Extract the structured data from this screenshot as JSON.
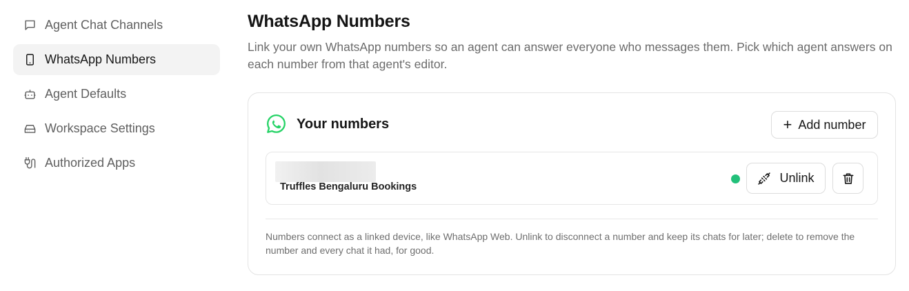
{
  "sidebar": {
    "items": [
      {
        "label": "Agent Chat Channels",
        "icon": "chat-bubble-icon",
        "active": false
      },
      {
        "label": "WhatsApp Numbers",
        "icon": "phone-icon",
        "active": true
      },
      {
        "label": "Agent Defaults",
        "icon": "robot-icon",
        "active": false
      },
      {
        "label": "Workspace Settings",
        "icon": "drive-icon",
        "active": false
      },
      {
        "label": "Authorized Apps",
        "icon": "plug-icon",
        "active": false
      }
    ]
  },
  "main": {
    "title": "WhatsApp Numbers",
    "description": "Link your own WhatsApp numbers so an agent can answer everyone who messages them. Pick which agent answers on each number from that agent's editor.",
    "card": {
      "title": "Your numbers",
      "add_label": "Add number",
      "numbers": [
        {
          "name": "Truffles Bengaluru Bookings",
          "status": "connected",
          "status_color": "#22c07a",
          "unlink_label": "Unlink"
        }
      ],
      "footnote": "Numbers connect as a linked device, like WhatsApp Web. Unlink to disconnect a number and keep its chats for later; delete to remove the number and every chat it had, for good."
    }
  },
  "colors": {
    "whatsapp_green": "#25d366",
    "status_connected": "#22c07a",
    "active_nav_bg": "#f3f3f3"
  }
}
